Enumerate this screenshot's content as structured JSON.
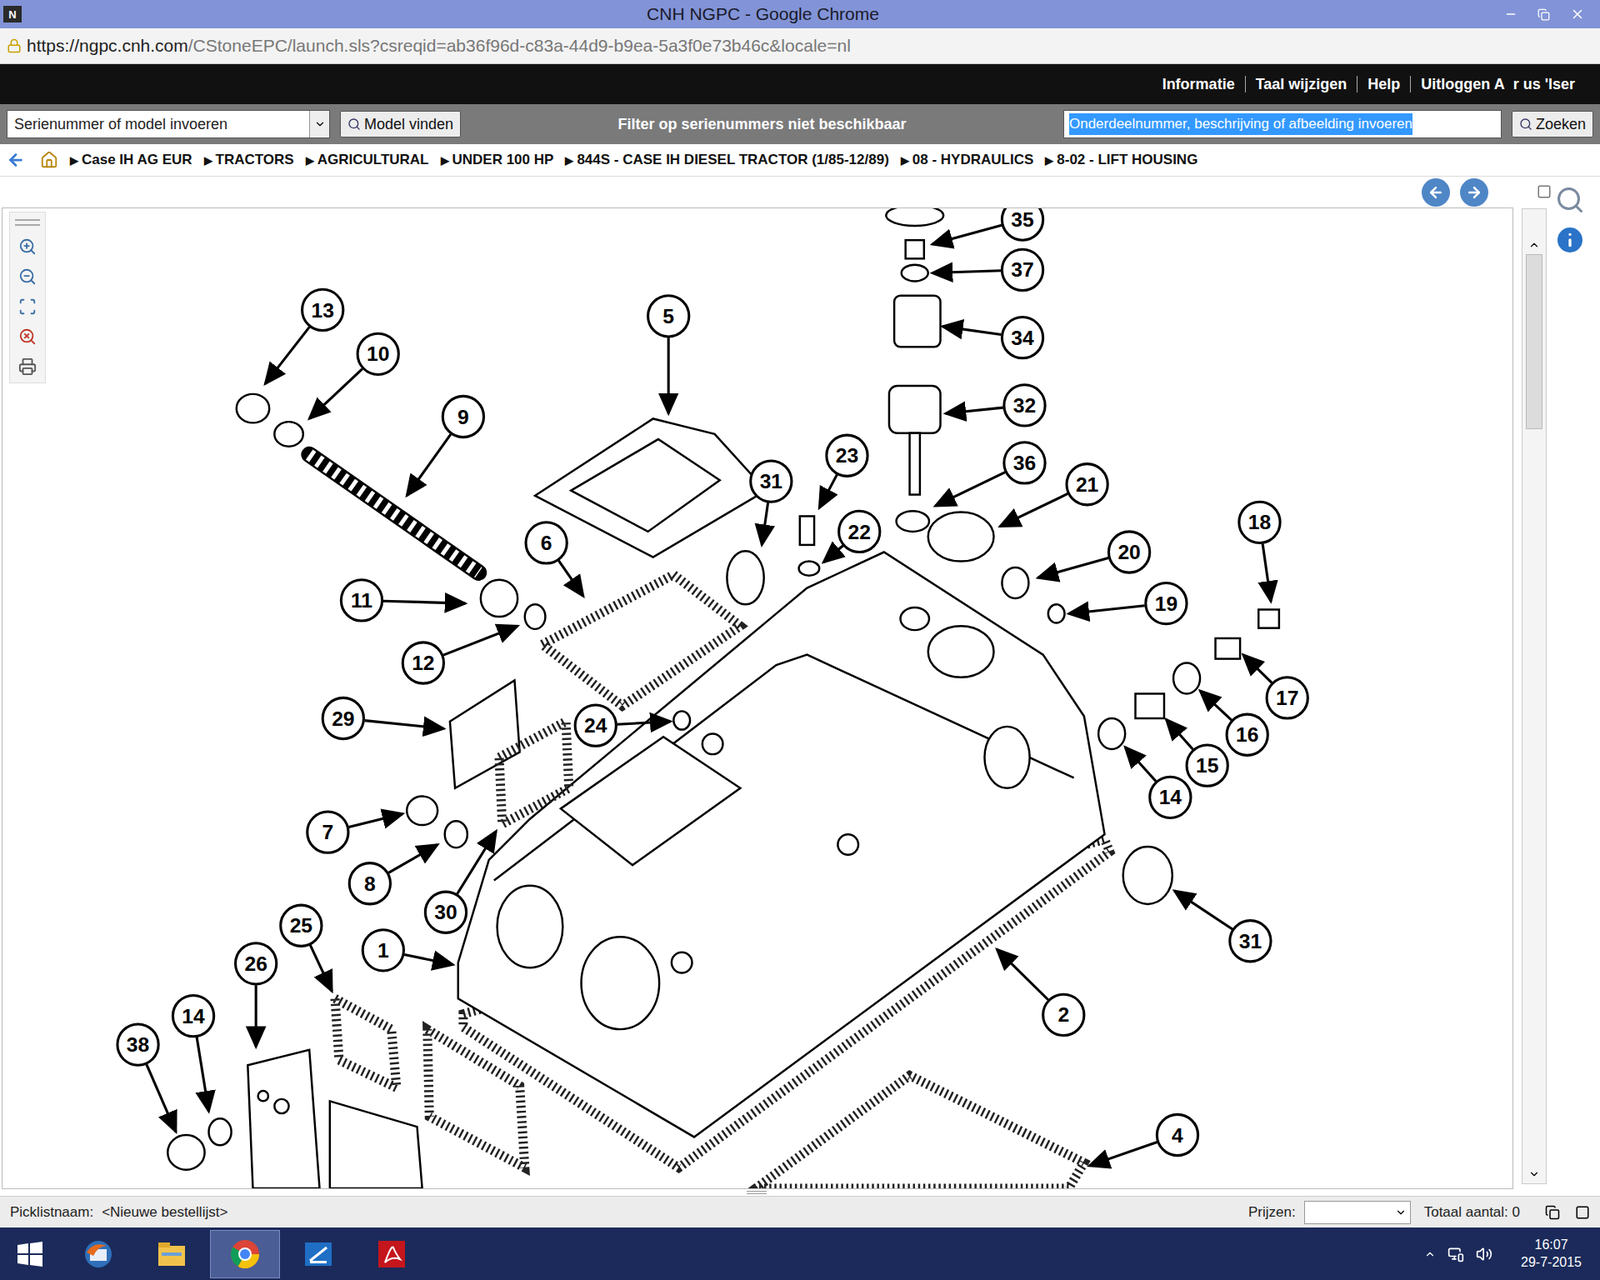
{
  "window": {
    "title": "CNH NGPC - Google Chrome",
    "app_icon": "N"
  },
  "address": {
    "host": "https://ngpc.cnh.com",
    "path": "/CStoneEPC/launch.sls?csreqid=ab36f96d-c83a-44d9-b9ea-5a3f0e73b46c&locale=nl"
  },
  "top_nav": {
    "items": [
      "Informatie",
      "Taal wijzigen",
      "Help",
      "Uitloggen A"
    ],
    "user": "r us 'lser"
  },
  "toolbar": {
    "model_placeholder": "Serienummer of model invoeren",
    "model_button": "Model vinden",
    "filter_text": "Filter op serienummers niet beschikbaar",
    "search_value": "Onderdeelnummer, beschrijving of afbeelding invoeren",
    "search_selected": true,
    "search_button": "Zoeken"
  },
  "breadcrumb": {
    "separator": "▶",
    "items": [
      "Case IH AG EUR",
      "TRACTORS",
      "AGRICULTURAL",
      "UNDER 100 HP",
      "844S - CASE IH DIESEL TRACTOR (1/85-12/89)",
      "08 - HYDRAULICS",
      "8-02 - LIFT HOUSING"
    ]
  },
  "diagram": {
    "callouts": [
      "13",
      "10",
      "9",
      "5",
      "31",
      "23",
      "22",
      "35",
      "37",
      "34",
      "32",
      "36",
      "21",
      "20",
      "18",
      "19",
      "6",
      "11",
      "12",
      "17",
      "16",
      "29",
      "24",
      "15",
      "14",
      "7",
      "8",
      "30",
      "31",
      "1",
      "2",
      "25",
      "26",
      "14",
      "38",
      "4"
    ]
  },
  "status_bar": {
    "picklist_label": "Picklistnaam:",
    "picklist_value": "<Nieuwe bestellijst>",
    "prices_label": "Prijzen:",
    "total": "Totaal aantal: 0"
  },
  "taskbar": {
    "items": [
      {
        "kind": "start",
        "selected": false
      },
      {
        "kind": "mail",
        "selected": false
      },
      {
        "kind": "files",
        "selected": false
      },
      {
        "kind": "browser",
        "selected": true
      },
      {
        "kind": "app",
        "selected": false
      },
      {
        "kind": "pdf",
        "selected": false
      }
    ],
    "time": "16:07",
    "date": "29-7-2015"
  }
}
